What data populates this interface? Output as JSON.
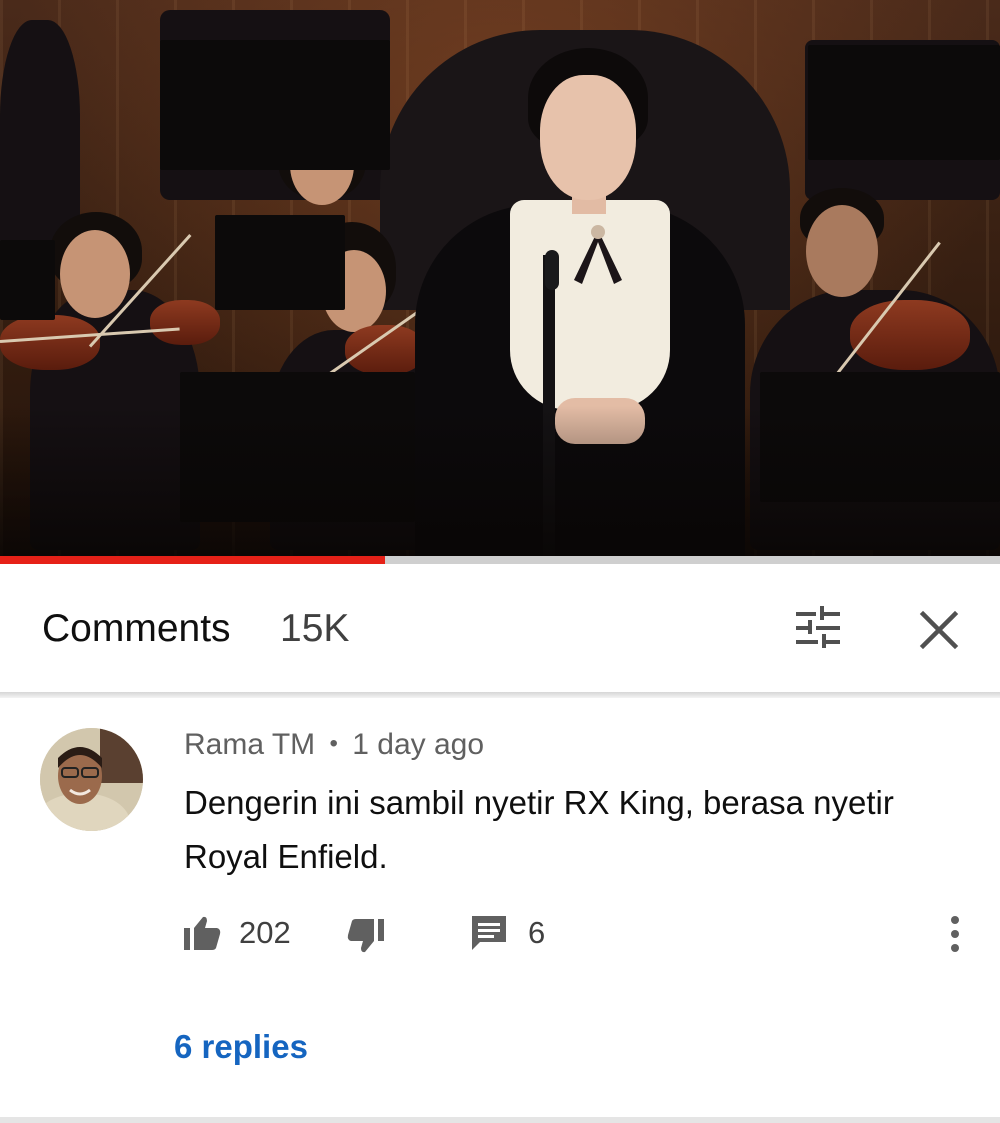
{
  "video": {
    "progress_fraction": 0.385
  },
  "comments_panel": {
    "title": "Comments",
    "count": "15K",
    "sort_icon": "sort-filter-icon",
    "close_icon": "close-icon"
  },
  "comment": {
    "author": "Rama TM",
    "separator": "•",
    "time": "1 day ago",
    "text": "Dengerin ini sambil nyetir RX King, berasa nyetir Royal Enfield.",
    "like_count": "202",
    "reply_count": "6",
    "replies_link": "6 replies"
  },
  "colors": {
    "progress": "#e62117",
    "link": "#1565c0",
    "text_secondary": "#606060"
  }
}
